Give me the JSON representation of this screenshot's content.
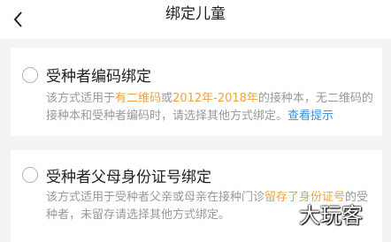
{
  "header": {
    "title": "绑定儿童",
    "back_icon": "chevron-left-icon"
  },
  "options": [
    {
      "title": "受种者编码绑定",
      "desc_1": "该方式适用于",
      "desc_hl_1": "有二维码",
      "desc_2": "或",
      "desc_hl_2": "2012年-2018年",
      "desc_3": "的接种本，无二维码的接种本和受种者编码时，请选择其他方式绑定。",
      "link": "查看提示"
    },
    {
      "title": "受种者父母身份证号绑定",
      "desc_1": "该方式适用于受种者父亲或母亲在接种门诊",
      "desc_hl_1": "留存了身份证号",
      "desc_2": "的受种者，未留存请选择其他方式绑定。"
    }
  ],
  "watermark": "大玩客",
  "colors": {
    "highlight": "#f0a33b",
    "link": "#3a8ee6"
  }
}
